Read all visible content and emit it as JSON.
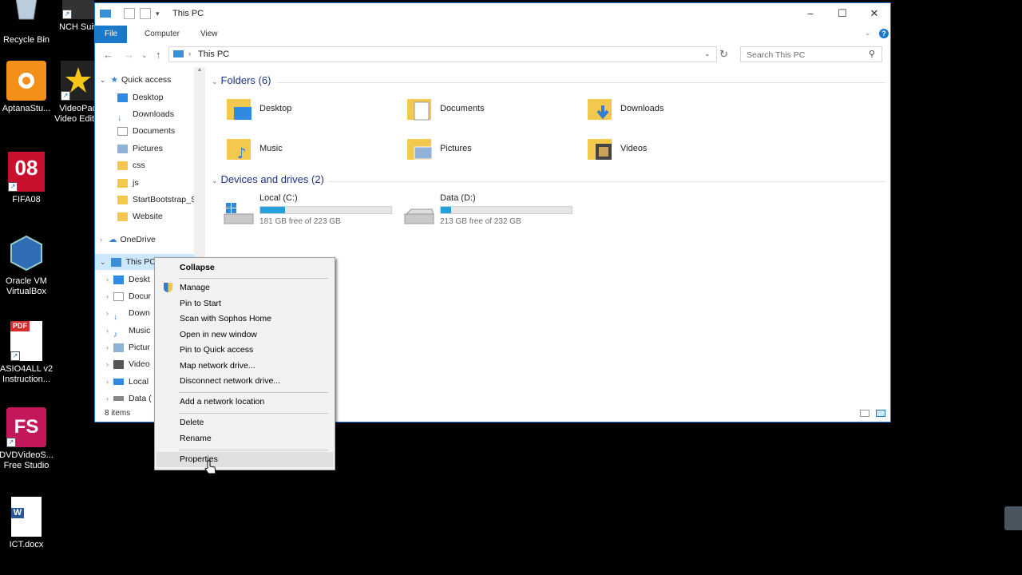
{
  "desktop": {
    "icons": [
      {
        "label": "Recycle Bin",
        "icon": "recycle-bin-icon"
      },
      {
        "label": "NCH Suite",
        "icon": "nch-suite-icon"
      },
      {
        "label": "AptanaStu...",
        "icon": "aptana-studio-icon"
      },
      {
        "label": "VideoPad Video Editor",
        "icon": "videopad-icon"
      },
      {
        "label": "FIFA08",
        "icon": "fifa08-icon"
      },
      {
        "label": "Oracle VM VirtualBox",
        "icon": "virtualbox-icon"
      },
      {
        "label": "ASIO4ALL v2 Instruction...",
        "icon": "pdf-icon"
      },
      {
        "label": "DVDVideoS... Free Studio",
        "icon": "free-studio-icon"
      },
      {
        "label": "ICT.docx",
        "icon": "word-doc-icon"
      }
    ],
    "icon_texts": {
      "fifa": "08",
      "pdf": "PDF",
      "fs": "FS",
      "word": "W"
    }
  },
  "window": {
    "title": "This PC",
    "ribbon_tabs": [
      "File",
      "Computer",
      "View"
    ],
    "address": "This PC",
    "search_placeholder": "Search This PC",
    "status": "8 items"
  },
  "nav_pane": {
    "quick_access": {
      "label": "Quick access",
      "items": [
        "Desktop",
        "Downloads",
        "Documents",
        "Pictures",
        "css",
        "js",
        "StartBootstrap_S",
        "Website"
      ]
    },
    "onedrive": "OneDrive",
    "this_pc": {
      "label": "This PC",
      "items": [
        "Deskt",
        "Docur",
        "Down",
        "Music",
        "Pictur",
        "Video",
        "Local",
        "Data ("
      ]
    }
  },
  "content": {
    "folders_header": "Folders (6)",
    "folders": [
      "Desktop",
      "Documents",
      "Downloads",
      "Music",
      "Pictures",
      "Videos"
    ],
    "drives_header": "Devices and drives (2)",
    "drives": [
      {
        "name": "Local (C:)",
        "free": "181 GB free of 223 GB",
        "used_fraction": 0.19
      },
      {
        "name": "Data (D:)",
        "free": "213 GB free of 232 GB",
        "used_fraction": 0.08
      }
    ]
  },
  "context_menu": {
    "items": [
      "Collapse",
      "Manage",
      "Pin to Start",
      "Scan with Sophos Home",
      "Open in new window",
      "Pin to Quick access",
      "Map network drive...",
      "Disconnect network drive...",
      "Add a network location",
      "Delete",
      "Rename",
      "Properties"
    ]
  },
  "colors": {
    "accent": "#1979ca",
    "drive_fill": "#26a0da",
    "folder": "#f2c94c",
    "header_text": "#1e3287"
  }
}
